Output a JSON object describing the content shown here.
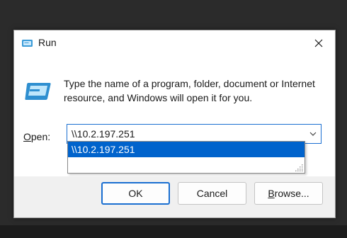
{
  "window": {
    "title": "Run",
    "close_icon": "close-icon",
    "app_icon": "run-icon"
  },
  "prompt": {
    "description": "Type the name of a program, folder, document or Internet resource, and Windows will open it for you."
  },
  "open_field": {
    "label_accel": "O",
    "label_rest": "pen:",
    "value": "\\\\10.2.197.251"
  },
  "dropdown": {
    "items": [
      "\\\\10.2.197.251"
    ]
  },
  "buttons": {
    "ok": "OK",
    "cancel": "Cancel",
    "browse_accel": "B",
    "browse_rest": "rowse..."
  },
  "colors": {
    "accent": "#0063cc",
    "focus_border": "#1a6fd1",
    "dialog_bg": "#f0f0f0"
  }
}
